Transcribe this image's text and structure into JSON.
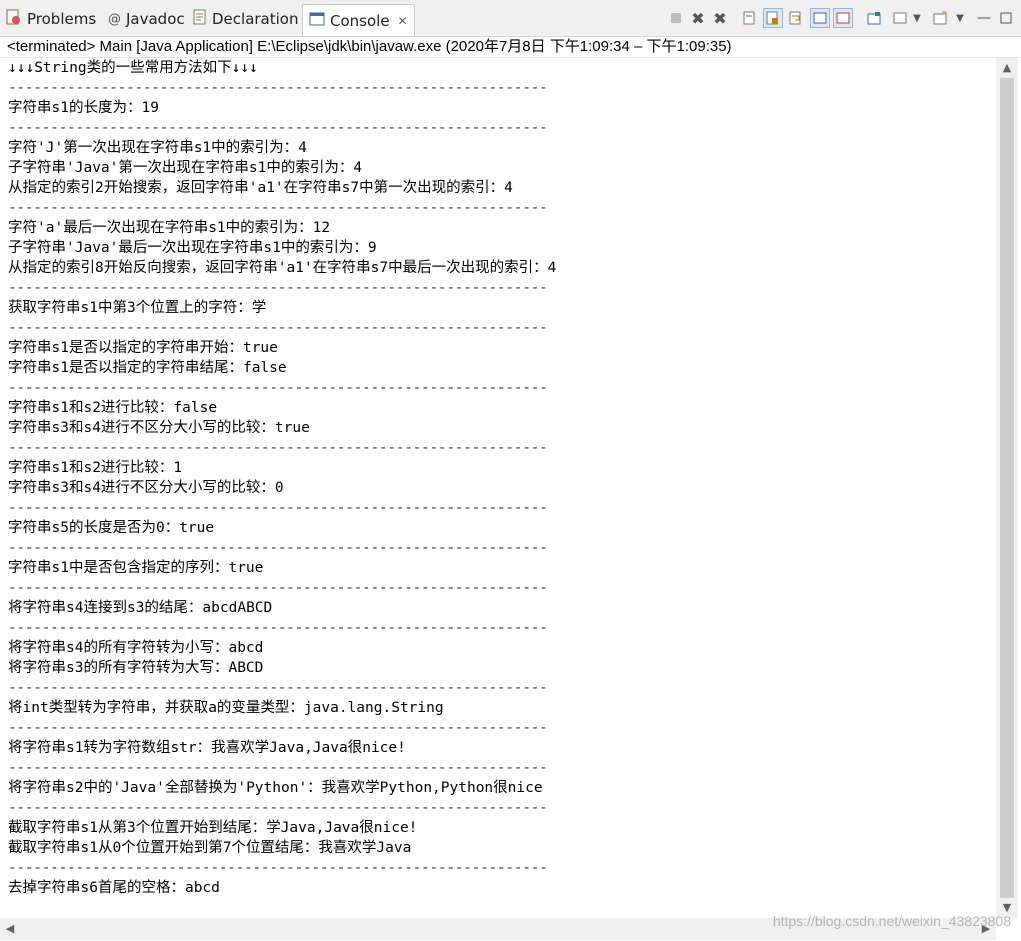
{
  "tabs": [
    {
      "label": "Problems",
      "icon": "problems-icon"
    },
    {
      "label": "Javadoc",
      "icon": "javadoc-icon"
    },
    {
      "label": "Declaration",
      "icon": "declaration-icon"
    },
    {
      "label": "Console",
      "icon": "console-icon",
      "active": true
    }
  ],
  "toolbar": {
    "terminate": "terminate-icon",
    "remove_launch": "remove-launch-icon",
    "remove_all": "remove-all-icon",
    "scroll_lock": "scroll-lock-icon",
    "word_wrap": "word-wrap-icon",
    "show_on_output": "show-console-icon",
    "display_selected": "display-selected-console-icon",
    "open_console": "open-console-icon",
    "minimize": "minimize-icon",
    "maximize": "maximize-icon"
  },
  "status": "<terminated> Main [Java Application] E:\\Eclipse\\jdk\\bin\\javaw.exe  (2020年7月8日 下午1:09:34 – 下午1:09:35)",
  "console_lines": [
    "↓↓↓String类的一些常用方法如下↓↓↓",
    "----------------------------------------------------------------",
    "字符串s1的长度为：19",
    "----------------------------------------------------------------",
    "字符'J'第一次出现在字符串s1中的索引为：4",
    "子字符串'Java'第一次出现在字符串s1中的索引为：4",
    "从指定的索引2开始搜索，返回字符串'a1'在字符串s7中第一次出现的索引：4",
    "----------------------------------------------------------------",
    "字符'a'最后一次出现在字符串s1中的索引为：12",
    "子字符串'Java'最后一次出现在字符串s1中的索引为：9",
    "从指定的索引8开始反向搜索，返回字符串'a1'在字符串s7中最后一次出现的索引：4",
    "----------------------------------------------------------------",
    "获取字符串s1中第3个位置上的字符：学",
    "----------------------------------------------------------------",
    "字符串s1是否以指定的字符串开始：true",
    "字符串s1是否以指定的字符串结尾：false",
    "----------------------------------------------------------------",
    "字符串s1和s2进行比较：false",
    "字符串s3和s4进行不区分大小写的比较：true",
    "----------------------------------------------------------------",
    "字符串s1和s2进行比较：1",
    "字符串s3和s4进行不区分大小写的比较：0",
    "----------------------------------------------------------------",
    "字符串s5的长度是否为0：true",
    "----------------------------------------------------------------",
    "字符串s1中是否包含指定的序列：true",
    "----------------------------------------------------------------",
    "将字符串s4连接到s3的结尾：abcdABCD",
    "----------------------------------------------------------------",
    "将字符串s4的所有字符转为小写：abcd",
    "将字符串s3的所有字符转为大写：ABCD",
    "----------------------------------------------------------------",
    "将int类型转为字符串，并获取a的变量类型：java.lang.String",
    "----------------------------------------------------------------",
    "将字符串s1转为字符数组str：我喜欢学Java,Java很nice!",
    "----------------------------------------------------------------",
    "将字符串s2中的'Java'全部替换为'Python'：我喜欢学Python,Python很nice",
    "----------------------------------------------------------------",
    "截取字符串s1从第3个位置开始到结尾：学Java,Java很nice!",
    "截取字符串s1从0个位置开始到第7个位置结尾：我喜欢学Java",
    "----------------------------------------------------------------",
    "去掉字符串s6首尾的空格：abcd"
  ],
  "watermark": "https://blog.csdn.net/weixin_43823808"
}
